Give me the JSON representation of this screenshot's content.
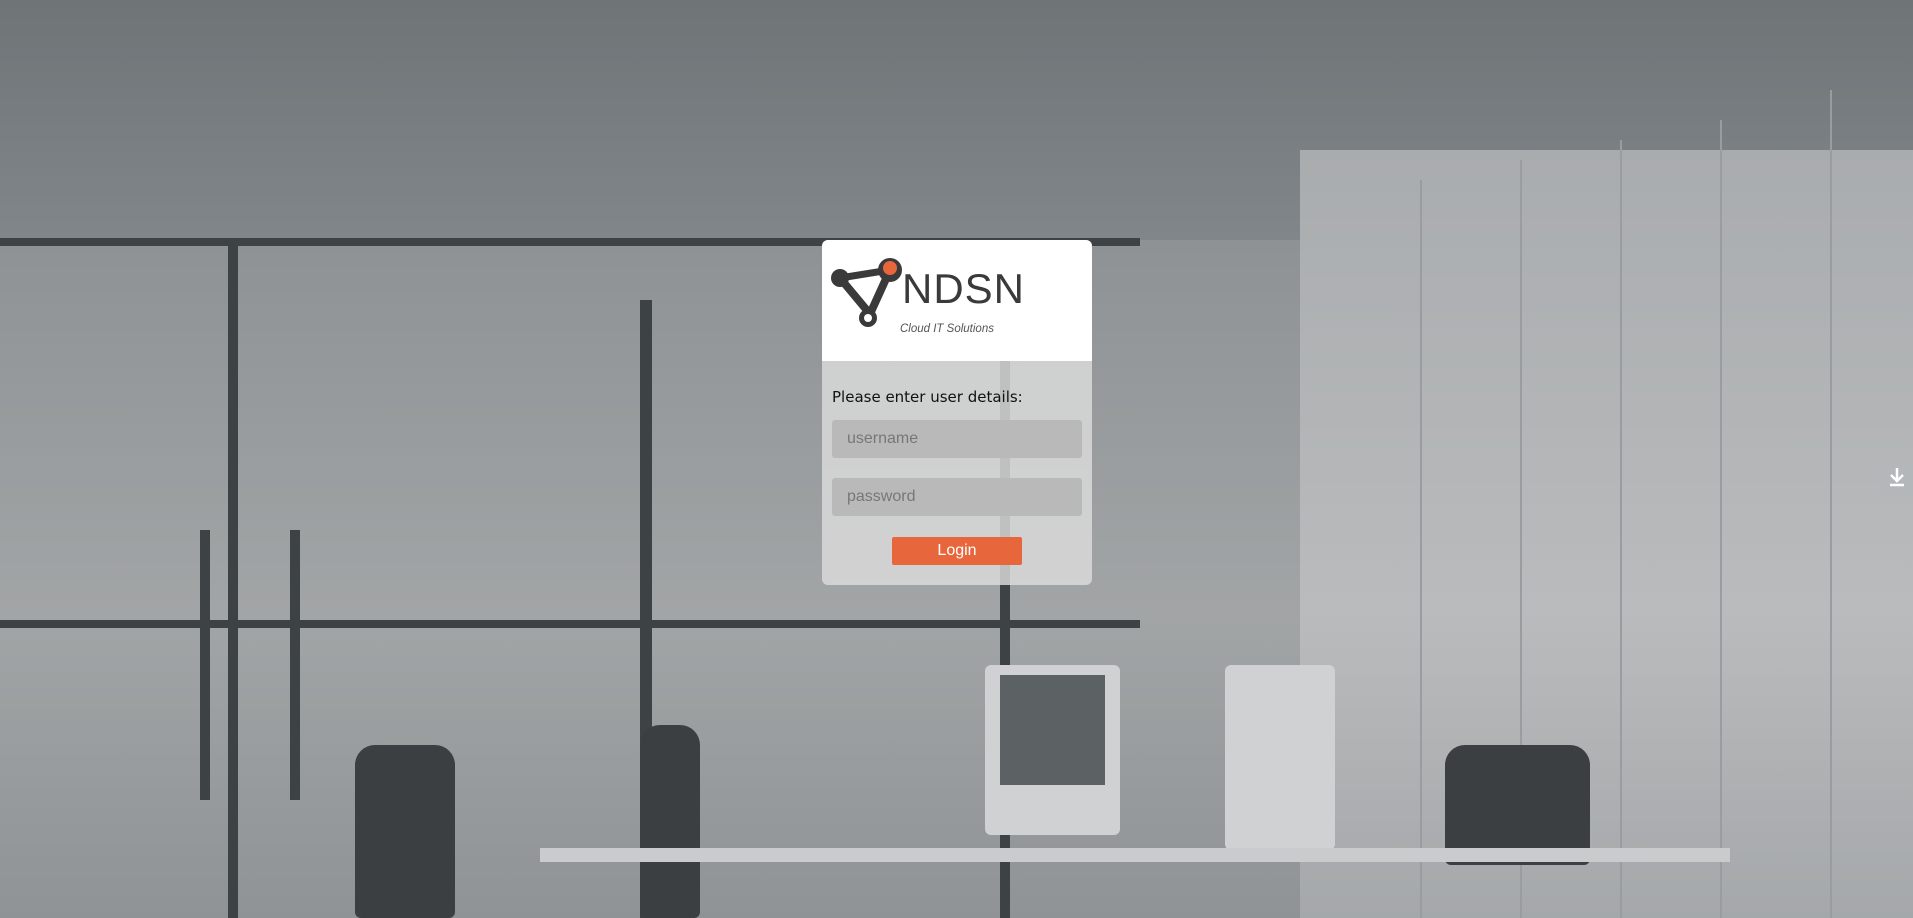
{
  "login": {
    "logo_text": "NDSN",
    "logo_tagline": "Cloud IT Solutions",
    "prompt": "Please enter user details:",
    "username_placeholder": "username",
    "password_placeholder": "password",
    "login_label": "Login"
  },
  "colors": {
    "accent": "#e8663c",
    "card_background": "#dcdcdc",
    "field_background": "#b9b9b9"
  },
  "icons": {
    "side_tab": "download-icon",
    "logo_mark": "molecule-logo-icon"
  }
}
